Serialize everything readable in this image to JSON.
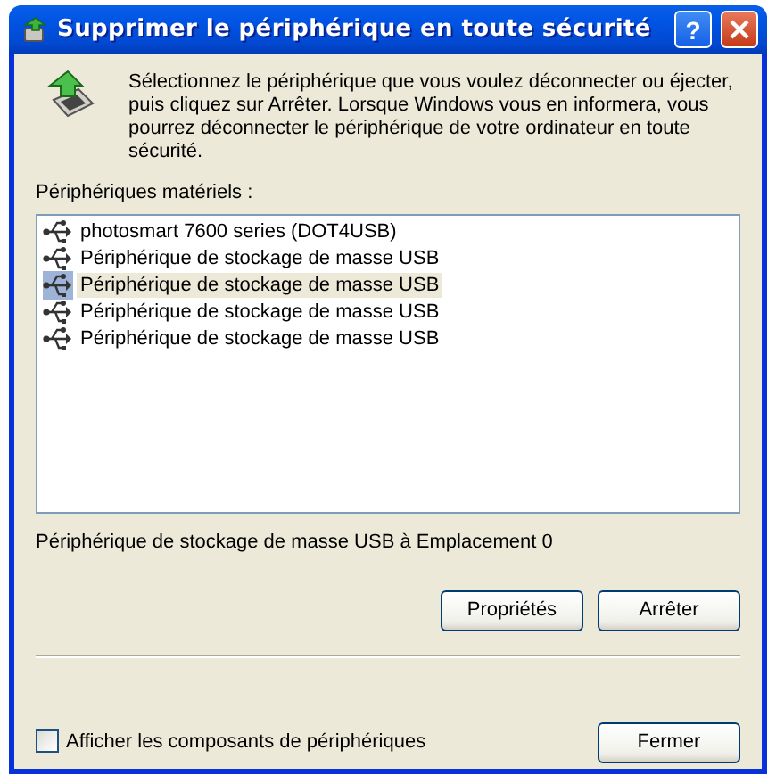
{
  "window": {
    "title": "Supprimer le périphérique en toute sécurité",
    "help": "?"
  },
  "intro": "Sélectionnez le périphérique que vous voulez déconnecter ou éjecter, puis cliquez sur Arrêter. Lorsque Windows vous en informera, vous pourrez déconnecter le périphérique de votre ordinateur en toute sécurité.",
  "devices_label": "Périphériques matériels :",
  "devices": [
    {
      "label": "photosmart 7600 series (DOT4USB)",
      "selected": false
    },
    {
      "label": "Périphérique de stockage de masse USB",
      "selected": false
    },
    {
      "label": "Périphérique de stockage de masse USB",
      "selected": true
    },
    {
      "label": "Périphérique de stockage de masse USB",
      "selected": false
    },
    {
      "label": "Périphérique de stockage de masse USB",
      "selected": false
    }
  ],
  "location": "Périphérique de stockage de masse USB à Emplacement 0",
  "buttons": [
    "Propriétés",
    "Arrêter"
  ],
  "show_components": {
    "label": "Afficher les composants de périphériques",
    "checked": false
  },
  "close_button": "Fermer"
}
